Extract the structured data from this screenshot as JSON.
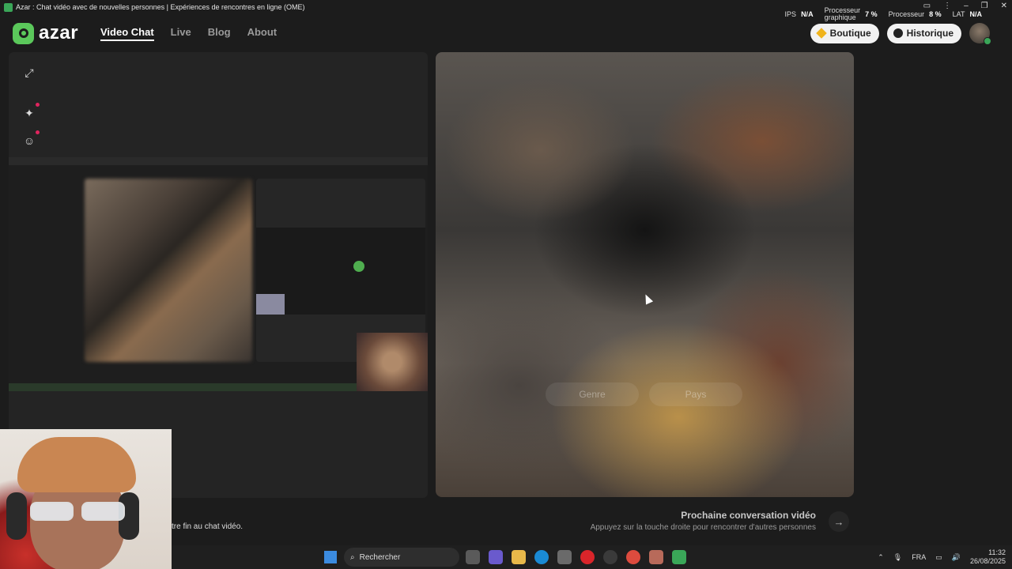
{
  "window": {
    "title": "Azar : Chat vidéo avec de nouvelles personnes | Expériences de rencontres en ligne (OME)"
  },
  "perf": {
    "ips_label": "IPS",
    "ips_value": "N/A",
    "gpu_label_1": "Processeur",
    "gpu_label_2": "graphique",
    "gpu_value": "7 %",
    "cpu_label": "Processeur",
    "cpu_value": "8 %",
    "lat_label": "LAT",
    "lat_value": "N/A"
  },
  "nav": {
    "brand": "azar",
    "links": [
      "Video Chat",
      "Live",
      "Blog",
      "About"
    ],
    "shop_label": "Boutique",
    "history_label": "Historique"
  },
  "right_panel": {
    "ghost_left": "Genre",
    "ghost_right": "Pays"
  },
  "footer": {
    "next_title": "Prochaine conversation vidéo",
    "next_sub": "Appuyez sur la touche droite pour rencontrer d'autres personnes",
    "end_text": "tre fin au chat vidéo."
  },
  "taskbar": {
    "search": "Rechercher",
    "lang": "FRA",
    "time": "11:32",
    "date": "26/08/2025"
  },
  "colors": {
    "accent": "#5bc85b",
    "notification": "#e0245e",
    "background": "#1c1c1c"
  }
}
